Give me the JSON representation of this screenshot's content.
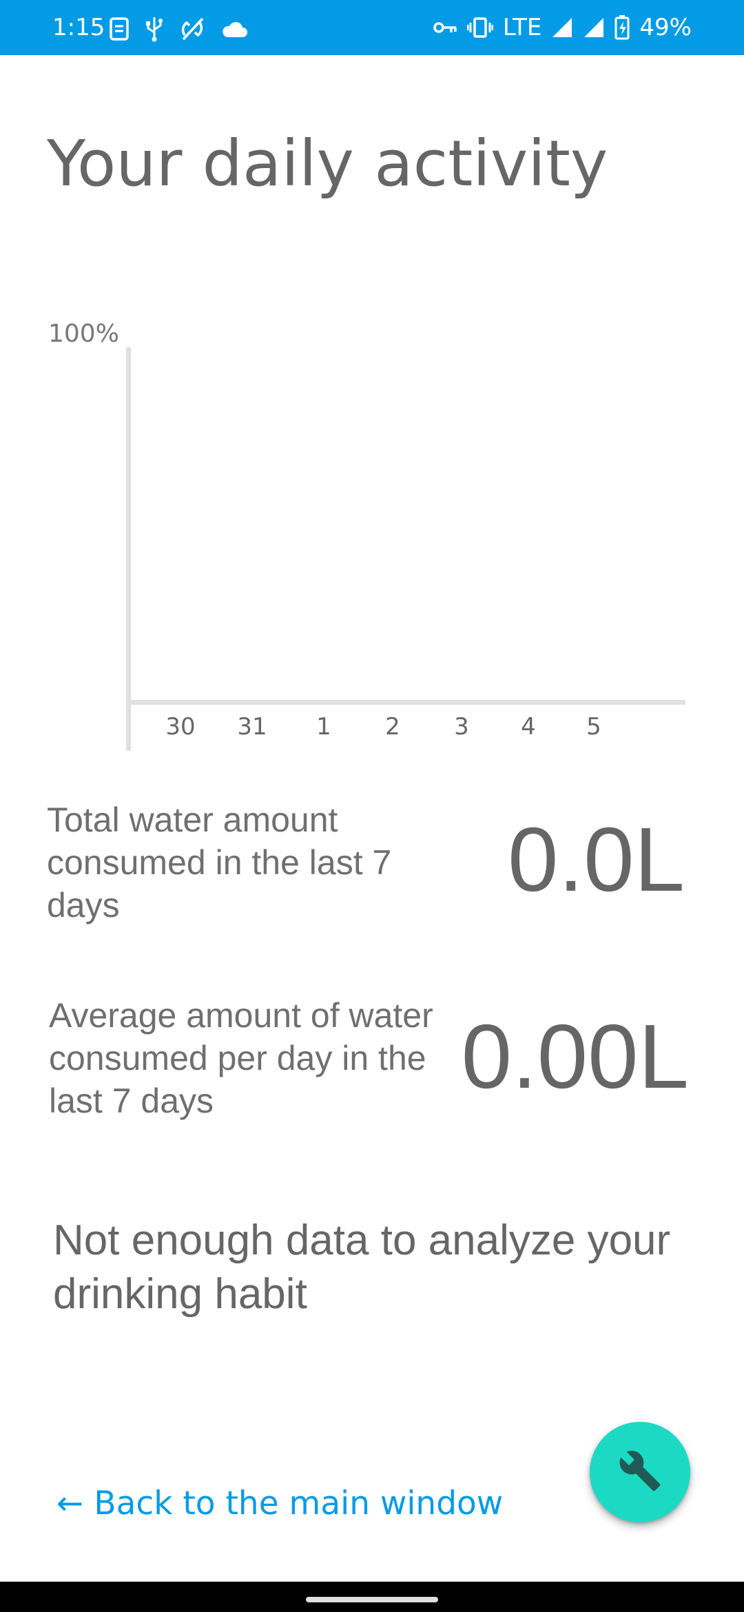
{
  "status_bar": {
    "time": "1:15",
    "network": "LTE",
    "battery": "49%",
    "icons": [
      "sim-icon",
      "usb-icon",
      "sync-off-icon",
      "cloud-icon",
      "vpn-key-icon",
      "vibrate-icon",
      "signal-icon",
      "signal-icon",
      "battery-charging-icon"
    ],
    "background_color": "#039BE5"
  },
  "page": {
    "title": "Your daily activity"
  },
  "chart_data": {
    "type": "bar",
    "categories": [
      "30",
      "31",
      "1",
      "2",
      "3",
      "4",
      "5"
    ],
    "values": [
      0,
      0,
      0,
      0,
      0,
      0,
      0
    ],
    "ylabel_top": "100%",
    "ylim": [
      0,
      100
    ],
    "grid": false
  },
  "stats": {
    "total": {
      "label": "Total water amount consumed in the last 7 days",
      "value": "0.0L"
    },
    "average": {
      "label": "Average amount of water consumed per day in the last 7 days",
      "value": "0.00L"
    }
  },
  "analysis": {
    "message": "Not enough data to analyze your drinking habit"
  },
  "navigation": {
    "back_label": "← Back to the main window"
  },
  "fab": {
    "icon": "wrench-icon",
    "color": "#1CD9C4"
  },
  "colors": {
    "accent": "#039BE5",
    "text": "#666666",
    "axis": "#e0e0e0"
  }
}
